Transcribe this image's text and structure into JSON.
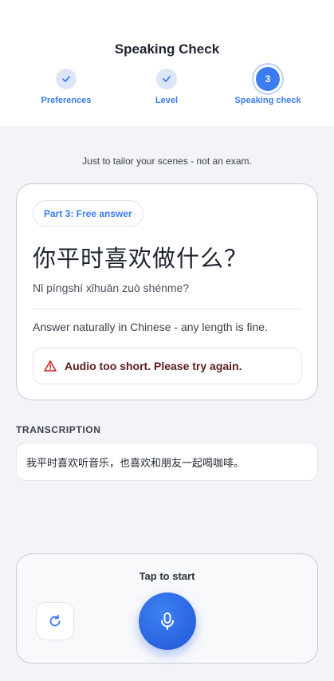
{
  "header": {
    "title": "Speaking Check",
    "steps": [
      {
        "label": "Preferences",
        "state": "done"
      },
      {
        "label": "Level",
        "state": "done"
      },
      {
        "label": "Speaking check",
        "state": "active",
        "number": "3"
      }
    ]
  },
  "subtitle": "Just to tailor your scenes - not an exam.",
  "card": {
    "badge": "Part 3: Free answer",
    "prompt_chinese": "你平时喜欢做什么？",
    "prompt_pinyin": "Nǐ píngshí xǐhuān zuò shénme?",
    "instruction": "Answer naturally in Chinese - any length is fine.",
    "error": "Audio too short. Please try again."
  },
  "transcription": {
    "label": "TRANSCRIPTION",
    "text": "我平时喜欢听音乐，也喜欢和朋友一起喝咖啡。"
  },
  "recorder": {
    "tap_label": "Tap to start"
  },
  "icons": {
    "check": "check-icon",
    "warning": "warning-icon",
    "retry": "refresh-icon",
    "mic": "microphone-icon"
  },
  "colors": {
    "accent": "#3b7cf0",
    "error_text": "#5c1a1a",
    "error_icon": "#c62828"
  }
}
